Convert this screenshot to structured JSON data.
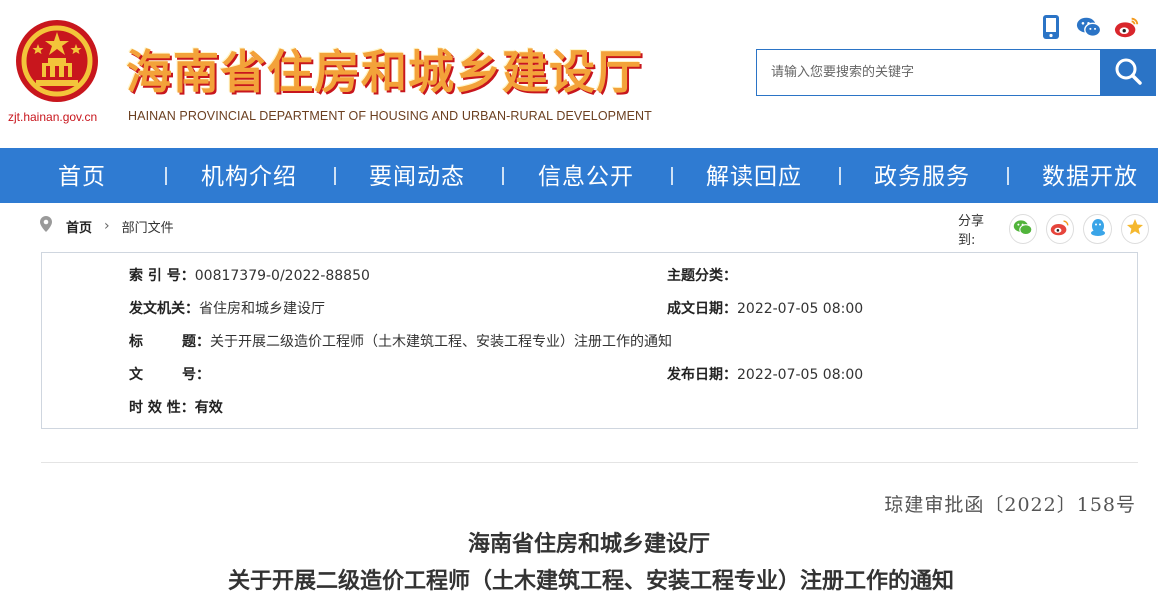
{
  "header": {
    "domain": "zjt.hainan.gov.cn",
    "title": "海南省住房和城乡建设厅",
    "subtitle": "HAINAN PROVINCIAL DEPARTMENT OF HOUSING AND URBAN-RURAL DEVELOPMENT",
    "icons": [
      "mobile-icon",
      "wechat-icon",
      "weibo-icon"
    ]
  },
  "search": {
    "placeholder": "请输入您要搜索的关键字",
    "button_icon": "search-icon"
  },
  "nav": {
    "items": [
      "首页",
      "机构介绍",
      "要闻动态",
      "信息公开",
      "解读回应",
      "政务服务",
      "数据开放"
    ]
  },
  "breadcrumb": {
    "home": "首页",
    "current": "部门文件"
  },
  "share": {
    "label": "分享到:",
    "icons": [
      "wechat-icon",
      "weibo-icon",
      "qq-icon",
      "qzone-icon"
    ]
  },
  "info": {
    "index_label": "索  引 号：",
    "index_value": "00817379-0/2022-88850",
    "topic_label": "主题分类：",
    "topic_value": "",
    "issuer_label": "发文机关：",
    "issuer_value": "省住房和城乡建设厅",
    "created_label": "成文日期：",
    "created_value": "2022-07-05 08:00",
    "title_label": "标        题：",
    "title_value": "关于开展二级造价工程师（土木建筑工程、安装工程专业）注册工作的通知",
    "docno_label": "文        号：",
    "docno_value": "",
    "published_label": "发布日期：",
    "published_value": "2022-07-05 08:00",
    "validity_label": "时 效 性：",
    "validity_value": "有效"
  },
  "document": {
    "number": "琼建审批函〔2022〕158号",
    "title_line1": "海南省住房和城乡建设厅",
    "title_line2": "关于开展二级造价工程师（土木建筑工程、安装工程专业）注册工作的通知"
  },
  "colors": {
    "nav_bg": "#2f7bd2",
    "search_border": "#2b74c6",
    "title_gold": "#f3a23a",
    "accent_red": "#c8161d"
  }
}
